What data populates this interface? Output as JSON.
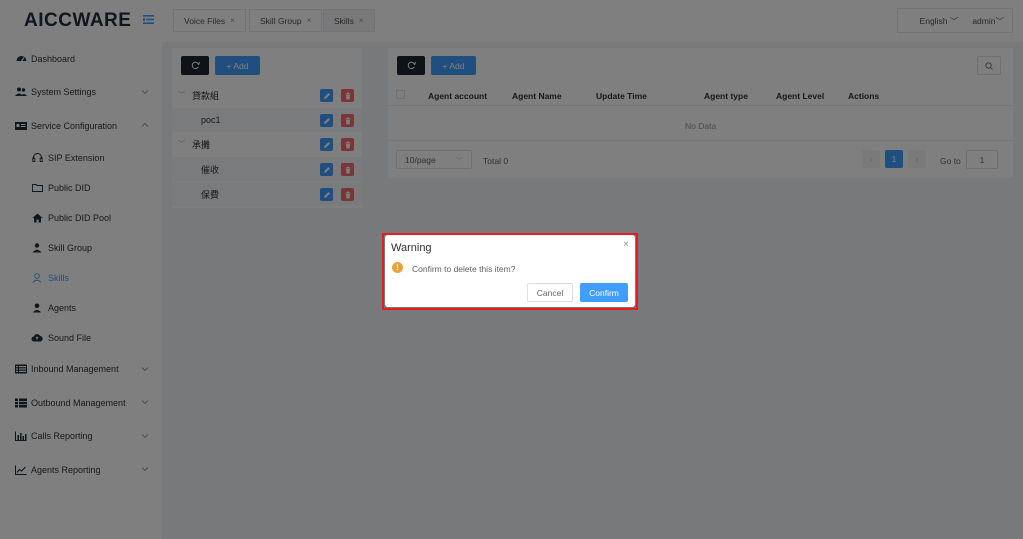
{
  "app": {
    "logo_part1": "AICC",
    "logo_part2": "WARE"
  },
  "sidebar": {
    "items": [
      {
        "label": "Dashboard"
      },
      {
        "label": "System Settings"
      },
      {
        "label": "Service Configuration"
      },
      {
        "label": "Inbound Management"
      },
      {
        "label": "Outbound Management"
      },
      {
        "label": "Calls Reporting"
      },
      {
        "label": "Agents Reporting"
      }
    ],
    "sub_items": [
      {
        "label": "SIP Extension"
      },
      {
        "label": "Public DID"
      },
      {
        "label": "Public DID Pool"
      },
      {
        "label": "Skill Group"
      },
      {
        "label": "Skills"
      },
      {
        "label": "Agents"
      },
      {
        "label": "Sound File"
      }
    ]
  },
  "tabs": [
    {
      "label": "Voice Files",
      "close": "×"
    },
    {
      "label": "Skill Group",
      "close": "×"
    },
    {
      "label": "Skills",
      "close": "×"
    }
  ],
  "header": {
    "language": "English",
    "user": "admin"
  },
  "tree_panel": {
    "add_label": "+ Add",
    "rows": [
      {
        "label": "貸款組"
      },
      {
        "label": "poc1"
      },
      {
        "label": "承攤"
      },
      {
        "label": "催收"
      },
      {
        "label": "保費"
      }
    ]
  },
  "table_panel": {
    "add_label": "+ Add",
    "columns": [
      "Agent account",
      "Agent Name",
      "Update Time",
      "Agent type",
      "Agent Level",
      "Actions"
    ],
    "empty_text": "No Data",
    "page_size": "10/page",
    "total": "Total 0",
    "current_page": "1",
    "goto_label": "Go to",
    "goto_value": "1"
  },
  "dialog": {
    "title": "Warning",
    "close": "×",
    "message": "Confirm to delete this item?",
    "cancel_label": "Cancel",
    "confirm_label": "Confirm"
  },
  "colors": {
    "primary": "#409eff",
    "danger": "#f56c6c",
    "warning": "#e6a23c",
    "dark": "#1f2633",
    "highlight": "#e51d1d"
  }
}
